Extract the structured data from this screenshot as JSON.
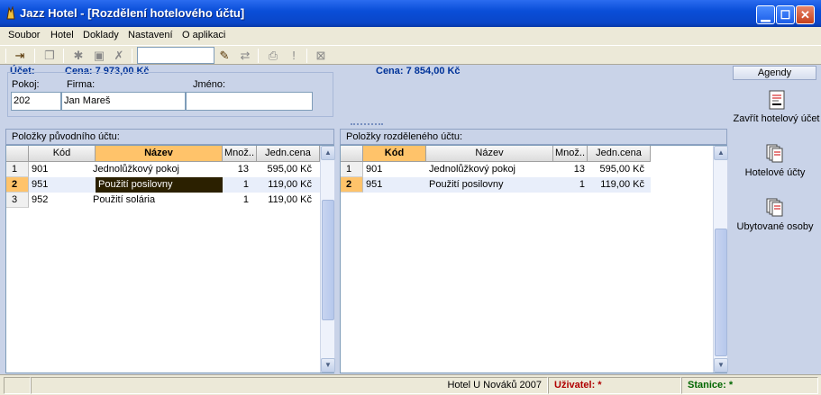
{
  "window": {
    "title": "Jazz Hotel - [Rozdělení hotelového účtu]"
  },
  "menu": [
    "Soubor",
    "Hotel",
    "Doklady",
    "Nastavení",
    "O aplikaci"
  ],
  "account": {
    "label": "Účet:",
    "price_left": "Cena: 7 973,00 Kč",
    "price_right": "Cena: 7 854,00 Kč",
    "room_label": "Pokoj:",
    "company_label": "Firma:",
    "name_label": "Jméno:",
    "room_value": "202",
    "company_value": "Jan Mareš",
    "name_value": ""
  },
  "left_grid": {
    "header": "Položky původního účtu:",
    "columns": [
      "Kód",
      "Název",
      "Množ..",
      "Jedn.cena"
    ],
    "rows": [
      {
        "n": "1",
        "code": "901",
        "name": "Jednolůžkový pokoj",
        "qty": "13",
        "price": "595,00 Kč"
      },
      {
        "n": "2",
        "code": "951",
        "name": "Použití posilovny",
        "qty": "1",
        "price": "119,00 Kč"
      },
      {
        "n": "3",
        "code": "952",
        "name": "Použití solária",
        "qty": "1",
        "price": "119,00 Kč"
      }
    ]
  },
  "right_grid": {
    "header": "Položky rozděleného účtu:",
    "columns": [
      "Kód",
      "Název",
      "Množ..",
      "Jedn.cena"
    ],
    "rows": [
      {
        "n": "1",
        "code": "901",
        "name": "Jednolůžkový pokoj",
        "qty": "13",
        "price": "595,00 Kč"
      },
      {
        "n": "2",
        "code": "951",
        "name": "Použití posilovny",
        "qty": "1",
        "price": "119,00 Kč"
      }
    ]
  },
  "sidebar": {
    "title": "Agendy",
    "items": [
      "Zavřít hotelový účet",
      "Hotelové účty",
      "Ubytované osoby"
    ]
  },
  "status": {
    "hotel": "Hotel U Nováků 2007",
    "user": "Uživatel: *",
    "station": "Stanice: *"
  }
}
